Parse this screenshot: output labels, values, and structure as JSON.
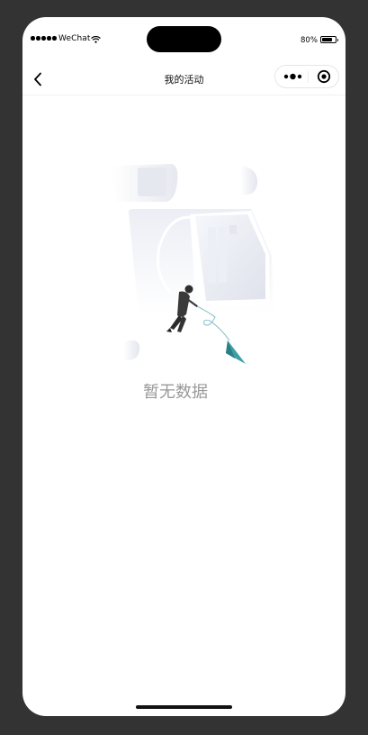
{
  "status_bar": {
    "carrier": "WeChat",
    "battery_percent": "80%",
    "battery_level": 0.8
  },
  "nav": {
    "title": "我的活动"
  },
  "empty_state": {
    "message": "暂无数据"
  },
  "colors": {
    "background": "#333333",
    "screen": "#ffffff",
    "empty_text": "#999999",
    "plane": "#3aa0a4"
  }
}
